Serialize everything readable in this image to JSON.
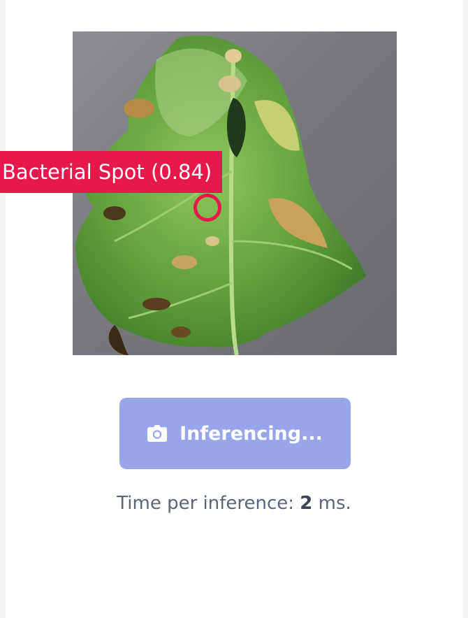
{
  "detection": {
    "label": "Bacterial Spot (0.84)",
    "color": "#e6194b"
  },
  "button": {
    "label": "Inferencing...",
    "icon": "camera-icon",
    "color": "#99a5ea"
  },
  "timing": {
    "prefix": "Time per inference: ",
    "value": "2",
    "suffix": " ms."
  }
}
